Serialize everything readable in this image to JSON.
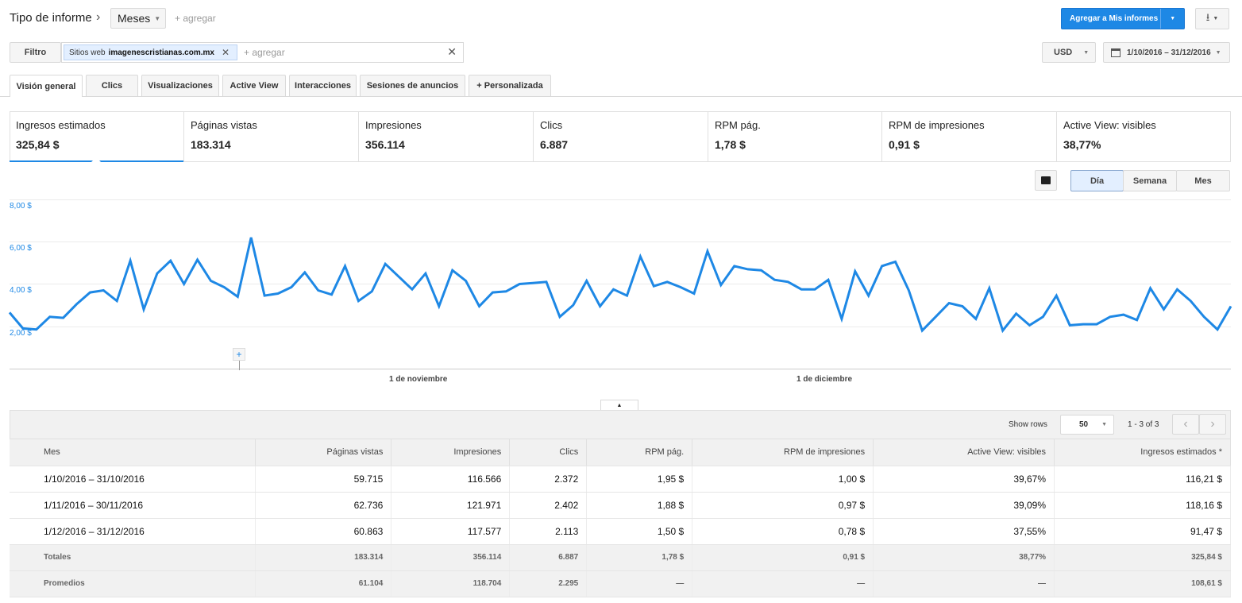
{
  "header": {
    "title": "Tipo de informe",
    "breadcrumb_sep": "›",
    "dimension": "Meses",
    "add_link": "+ agregar",
    "add_report_btn": "Agregar a Mis informes"
  },
  "filter": {
    "label": "Filtro",
    "chip_prefix": "Sitios web",
    "chip_value": "imagenescristianas.com.mx",
    "add_placeholder": "+ agregar",
    "currency": "USD",
    "date_range": "1/10/2016 – 31/12/2016"
  },
  "tabs": [
    "Visión general",
    "Clics",
    "Visualizaciones",
    "Active View",
    "Interacciones",
    "Sesiones de anuncios",
    "+ Personalizada"
  ],
  "metrics": [
    {
      "label": "Ingresos estimados",
      "value": "325,84 $"
    },
    {
      "label": "Páginas vistas",
      "value": "183.314"
    },
    {
      "label": "Impresiones",
      "value": "356.114"
    },
    {
      "label": "Clics",
      "value": "6.887"
    },
    {
      "label": "RPM pág.",
      "value": "1,78 $"
    },
    {
      "label": "RPM de impresiones",
      "value": "0,91 $"
    },
    {
      "label": "Active View: visibles",
      "value": "38,77%"
    }
  ],
  "granularity": {
    "day": "Día",
    "week": "Semana",
    "month": "Mes",
    "selected": "Día"
  },
  "chart_data": {
    "type": "line",
    "x_tick_labels": [
      "1 de noviembre",
      "1 de diciembre"
    ],
    "y_tick_labels": [
      "2,00 $",
      "4,00 $",
      "6,00 $",
      "8,00 $"
    ],
    "ylim": [
      0,
      8
    ],
    "color": "#1e88e5",
    "series": [
      {
        "values": [
          2.65,
          1.9,
          1.85,
          2.45,
          2.4,
          3.05,
          3.6,
          3.7,
          3.2,
          5.1,
          2.8,
          4.5,
          5.1,
          4.0,
          5.15,
          4.15,
          3.85,
          3.4,
          6.2,
          3.45,
          3.55,
          3.85,
          4.55,
          3.7,
          3.5,
          4.85,
          3.2,
          3.65,
          4.95,
          4.35,
          3.75,
          4.5,
          2.95,
          4.65,
          4.15,
          2.95,
          3.6,
          3.65,
          4.0,
          4.05,
          4.1,
          2.45,
          3.0,
          4.15,
          2.95,
          3.75,
          3.45,
          5.3,
          3.9,
          4.1,
          3.85,
          3.55,
          5.55,
          3.95,
          4.85,
          4.7,
          4.65,
          4.2,
          4.1,
          3.75,
          3.75,
          4.2,
          2.35,
          4.6,
          3.45,
          4.85,
          5.05,
          3.7,
          1.8,
          2.45,
          3.1,
          2.95,
          2.35,
          3.8,
          1.8,
          2.6,
          2.05,
          2.45,
          3.45,
          2.05,
          2.1,
          2.1,
          2.45,
          2.55,
          2.3,
          3.8,
          2.8,
          3.75,
          3.2,
          2.45,
          1.85,
          2.95
        ]
      }
    ]
  },
  "table": {
    "show_rows_label": "Show rows",
    "rows_value": "50",
    "pagination": "1 - 3 of 3",
    "headers": [
      "Mes",
      "Páginas vistas",
      "Impresiones",
      "Clics",
      "RPM pág.",
      "RPM de impresiones",
      "Active View: visibles",
      "Ingresos estimados *"
    ],
    "rows": [
      [
        "1/10/2016 – 31/10/2016",
        "59.715",
        "116.566",
        "2.372",
        "1,95 $",
        "1,00 $",
        "39,67%",
        "116,21 $"
      ],
      [
        "1/11/2016 – 30/11/2016",
        "62.736",
        "121.971",
        "2.402",
        "1,88 $",
        "0,97 $",
        "39,09%",
        "118,16 $"
      ],
      [
        "1/12/2016 – 31/12/2016",
        "60.863",
        "117.577",
        "2.113",
        "1,50 $",
        "0,78 $",
        "37,55%",
        "91,47 $"
      ]
    ],
    "totals": [
      "Totales",
      "183.314",
      "356.114",
      "6.887",
      "1,78 $",
      "0,91 $",
      "38,77%",
      "325,84 $"
    ],
    "averages": [
      "Promedios",
      "61.104",
      "118.704",
      "2.295",
      "—",
      "—",
      "—",
      "108,61 $"
    ]
  }
}
